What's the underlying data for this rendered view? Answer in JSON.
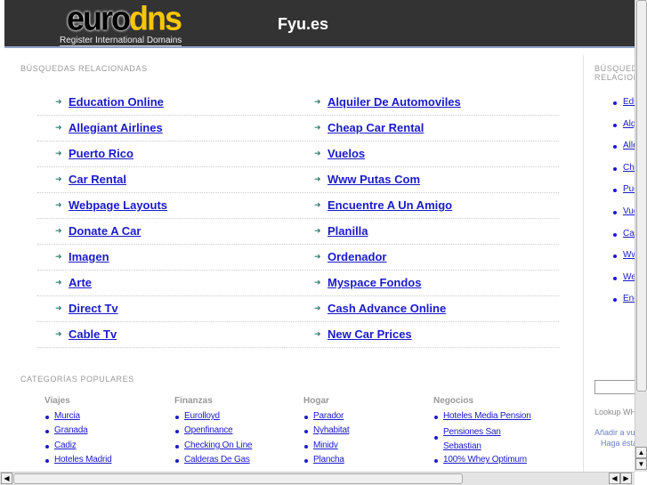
{
  "header": {
    "logo_euro": "euro",
    "logo_dns": "dns",
    "logo_tagline": "Register International Domains",
    "site_title": "Fyu.es"
  },
  "related": {
    "title": "BÚSQUEDAS RELACIONADAS",
    "left": [
      "Education Online",
      "Allegiant Airlines",
      "Puerto Rico",
      "Car Rental",
      "Webpage Layouts",
      "Donate A Car",
      "Imagen",
      "Arte",
      "Direct Tv",
      "Cable Tv"
    ],
    "right": [
      "Alquiler De Automoviles",
      "Cheap Car Rental",
      "Vuelos",
      "Www Putas Com",
      "Encuentre A Un Amigo",
      "Planilla",
      "Ordenador",
      "Myspace Fondos",
      "Cash Advance Online",
      "New Car Prices"
    ]
  },
  "categories": {
    "title": "CATEGORÍAS POPULARES",
    "columns": [
      {
        "heading": "Viajes",
        "items": [
          "Murcia",
          "Granada",
          "Cadiz",
          "Hoteles Madrid"
        ]
      },
      {
        "heading": "Finanzas",
        "items": [
          "Eurolloyd",
          "Openfinance",
          "Checking On Line",
          "Calderas De Gas"
        ]
      },
      {
        "heading": "Hogar",
        "items": [
          "Parador",
          "Nyhabitat",
          "Minidv",
          "Plancha"
        ]
      },
      {
        "heading": "Negocios",
        "items": [
          "Hoteles Media Pension",
          "Pensiones San Sebastian",
          "100% Whey Optimum"
        ]
      }
    ]
  },
  "sidebar": {
    "title": "BÚSQUEDAS RELACIONADAS",
    "items": [
      "Education Online",
      "Alquiler De Automoviles",
      "Allegiant Airlines",
      "Cheap Car Rental",
      "Puerto Rico",
      "Vuelos",
      "Car Rental",
      "Www Putas Com",
      "Webpage Layouts",
      "Encuentre A Un Amigo"
    ],
    "lookup": "Lookup WHOIS",
    "add": "Añadir a vuestros favoritos",
    "make": "Haga ésta su página de inicio"
  }
}
